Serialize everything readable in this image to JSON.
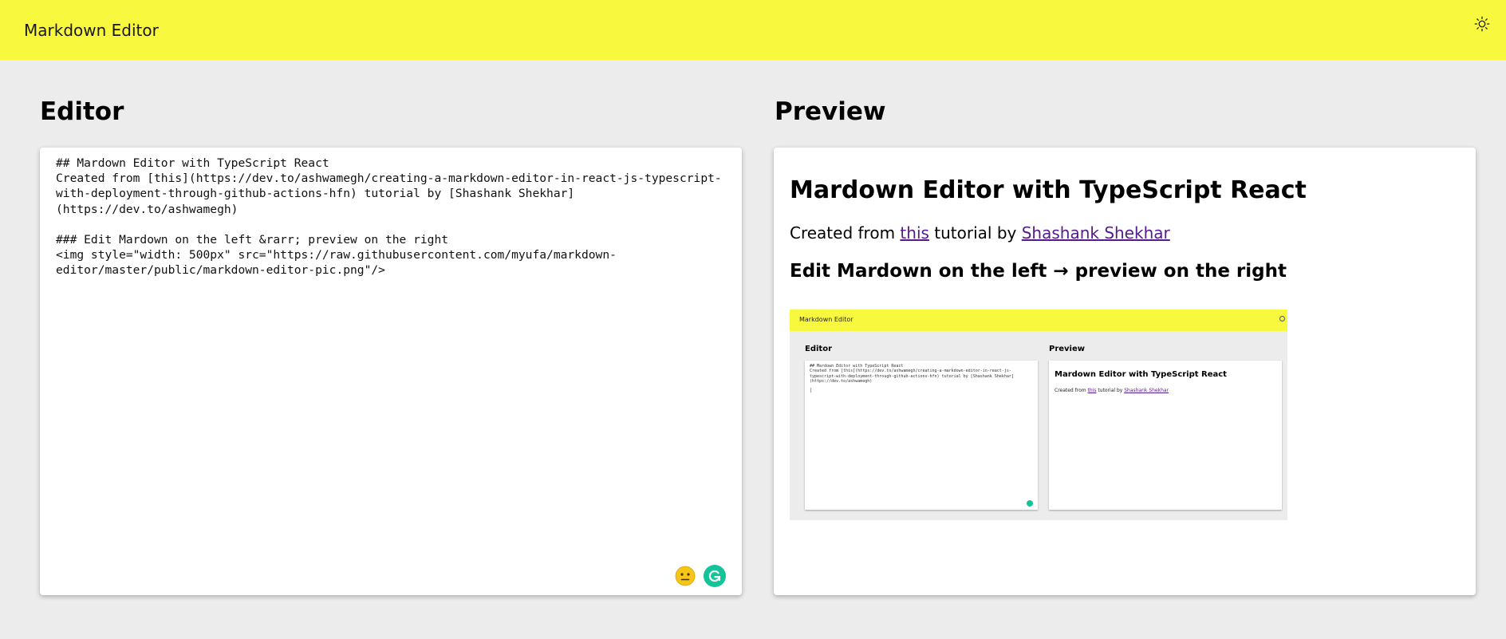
{
  "header": {
    "title": "Markdown Editor",
    "theme_toggle_icon": "sun-icon",
    "background_color": "#f8f83f"
  },
  "editor": {
    "section_title": "Editor",
    "content": "## Mardown Editor with TypeScript React\nCreated from [this](https://dev.to/ashwamegh/creating-a-markdown-editor-in-react-js-typescript-with-deployment-through-github-actions-hfn) tutorial by [Shashank Shekhar](https://dev.to/ashwamegh)\n\n### Edit Mardown on the left &rarr; preview on the right\n<img style=\"width: 500px\" src=\"https://raw.githubusercontent.com/myufa/markdown-editor/master/public/markdown-editor-pic.png\"/>",
    "emoji_icon": "neutral-face-icon",
    "grammarly_icon": "grammarly-icon"
  },
  "preview": {
    "section_title": "Preview",
    "heading": "Mardown Editor with TypeScript React",
    "paragraph_prefix": "Created from ",
    "link_this": "this",
    "paragraph_middle": " tutorial by ",
    "link_author": "Shashank Shekhar",
    "subheading": "Edit Mardown on the left → preview on the right",
    "image": {
      "bar_title": "Markdown Editor",
      "editor_label": "Editor",
      "preview_label": "Preview",
      "code_text": "## Mardown Editor with TypeScript React\nCreated from [this](https://dev.to/ashwamegh/creating-a-markdown-editor-in-react-js-\ntypescript-with-deployment-through-github-actions-hfn) tutorial by [Shashank Shekhar]\n(https://dev.to/ashwamegh)",
      "cursor": "|",
      "preview_heading": "Mardown Editor with TypeScript React",
      "preview_prefix": "Created from ",
      "preview_link_this": "this",
      "preview_middle": " tutorial by ",
      "preview_link_author": "Shashank Shekhar"
    }
  }
}
